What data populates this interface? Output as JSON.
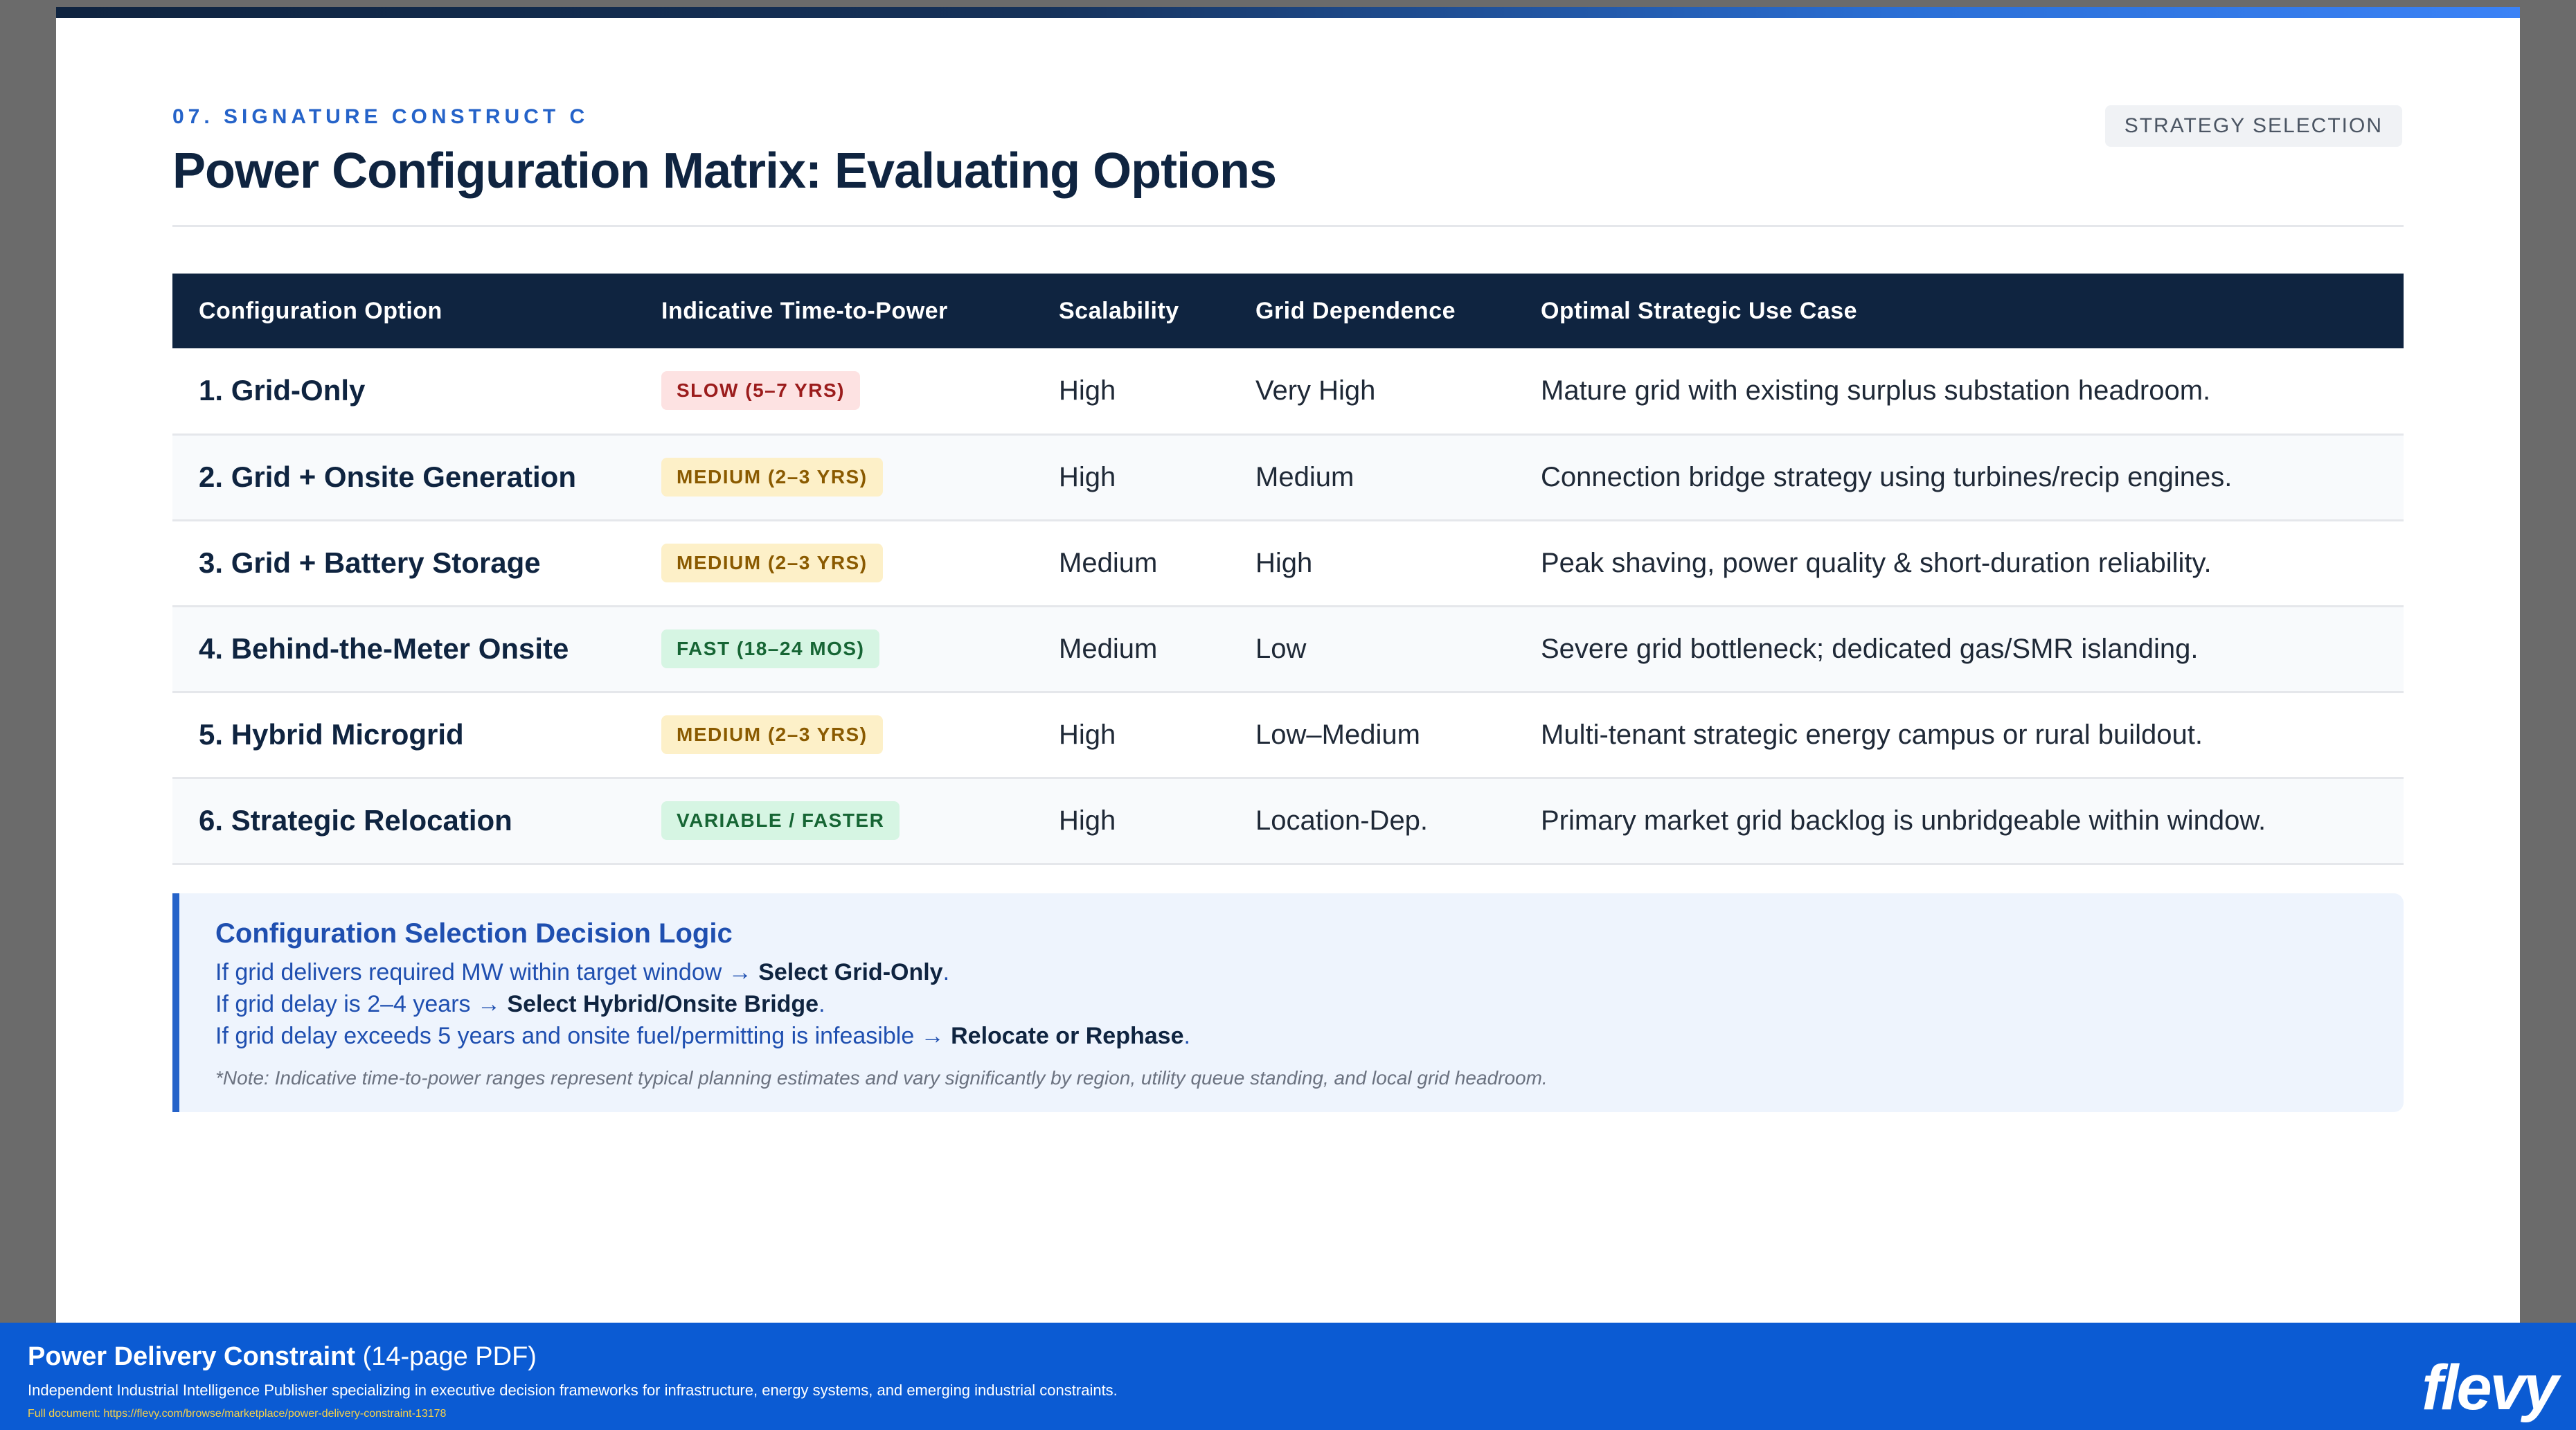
{
  "header": {
    "section_label": "07. SIGNATURE CONSTRUCT C",
    "title": "Power Configuration Matrix: Evaluating Options",
    "tag": "STRATEGY SELECTION"
  },
  "table": {
    "columns": [
      "Configuration Option",
      "Indicative Time-to-Power",
      "Scalability",
      "Grid Dependence",
      "Optimal Strategic Use Case"
    ],
    "rows": [
      {
        "option": "1. Grid-Only",
        "time": "SLOW (5–7 YRS)",
        "time_level": "slow",
        "scalability": "High",
        "grid": "Very High",
        "use_case": "Mature grid with existing surplus substation headroom."
      },
      {
        "option": "2. Grid + Onsite Generation",
        "time": "MEDIUM (2–3 YRS)",
        "time_level": "medium",
        "scalability": "High",
        "grid": "Medium",
        "use_case": "Connection bridge strategy using turbines/recip engines."
      },
      {
        "option": "3. Grid + Battery Storage",
        "time": "MEDIUM (2–3 YRS)",
        "time_level": "medium",
        "scalability": "Medium",
        "grid": "High",
        "use_case": "Peak shaving, power quality & short-duration reliability."
      },
      {
        "option": "4. Behind-the-Meter Onsite",
        "time": "FAST (18–24 MOS)",
        "time_level": "fast",
        "scalability": "Medium",
        "grid": "Low",
        "use_case": "Severe grid bottleneck; dedicated gas/SMR islanding."
      },
      {
        "option": "5. Hybrid Microgrid",
        "time": "MEDIUM (2–3 YRS)",
        "time_level": "medium",
        "scalability": "High",
        "grid": "Low–Medium",
        "use_case": "Multi-tenant strategic energy campus or rural buildout."
      },
      {
        "option": "6. Strategic Relocation",
        "time": "VARIABLE / FASTER",
        "time_level": "fast",
        "scalability": "High",
        "grid": "Location-Dep.",
        "use_case": "Primary market grid backlog is unbridgeable within window."
      }
    ]
  },
  "logic": {
    "title": "Configuration Selection Decision Logic",
    "lines": [
      {
        "text": "If grid delivers required MW within target window → ",
        "action": "Select Grid-Only",
        "end": "."
      },
      {
        "text": "If grid delay is 2–4 years → ",
        "action": "Select Hybrid/Onsite Bridge",
        "end": "."
      },
      {
        "text": "If grid delay exceeds 5 years and onsite fuel/permitting is infeasible → ",
        "action": "Relocate or Rephase",
        "end": "."
      }
    ],
    "note": "*Note: Indicative time-to-power ranges represent typical planning estimates and vary significantly by region, utility queue standing, and local grid headroom."
  },
  "footer": {
    "doc_name": "Power Delivery Constraint",
    "doc_pages": "(14-page PDF)",
    "description": "Independent Industrial Intelligence Publisher specializing in executive decision frameworks for infrastructure, energy systems, and emerging industrial constraints.",
    "link": "Full document: https://flevy.com/browse/marketplace/power-delivery-constraint-13178",
    "logo": "flevy"
  },
  "colors": {
    "navy": "#0f2440",
    "accent": "#2563c9",
    "footer_blue": "#0b5bd3",
    "slow": "#fde2e2",
    "medium": "#fdf0c8",
    "fast": "#d6f5e3"
  }
}
